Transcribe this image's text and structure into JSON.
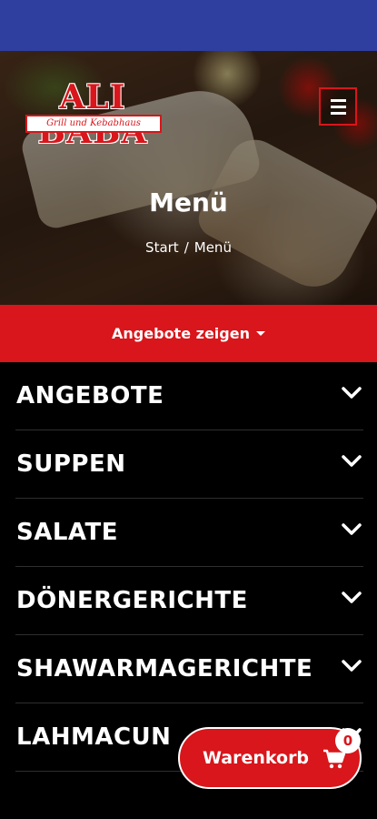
{
  "brand": {
    "name": "ALI BABA",
    "tagline": "Grill und Kebabhaus",
    "accent_color": "#d8161b",
    "status_bar_color": "#2e3fa0"
  },
  "header": {
    "menu_icon": "hamburger-menu-icon"
  },
  "hero": {
    "title": "Menü",
    "breadcrumb": {
      "home": "Start",
      "separator": "/",
      "current": "Menü"
    }
  },
  "offers_bar": {
    "label": "Angebote zeigen",
    "icon": "caret-down-icon"
  },
  "categories": [
    {
      "label": "ANGEBOTE"
    },
    {
      "label": "SUPPEN"
    },
    {
      "label": "SALATE"
    },
    {
      "label": "DÖNERGERICHTE"
    },
    {
      "label": "SHAWARMAGERICHTE"
    },
    {
      "label": "LAHMACUN"
    }
  ],
  "cart": {
    "label": "Warenkorb",
    "count": "0",
    "icon": "shopping-cart-icon"
  }
}
